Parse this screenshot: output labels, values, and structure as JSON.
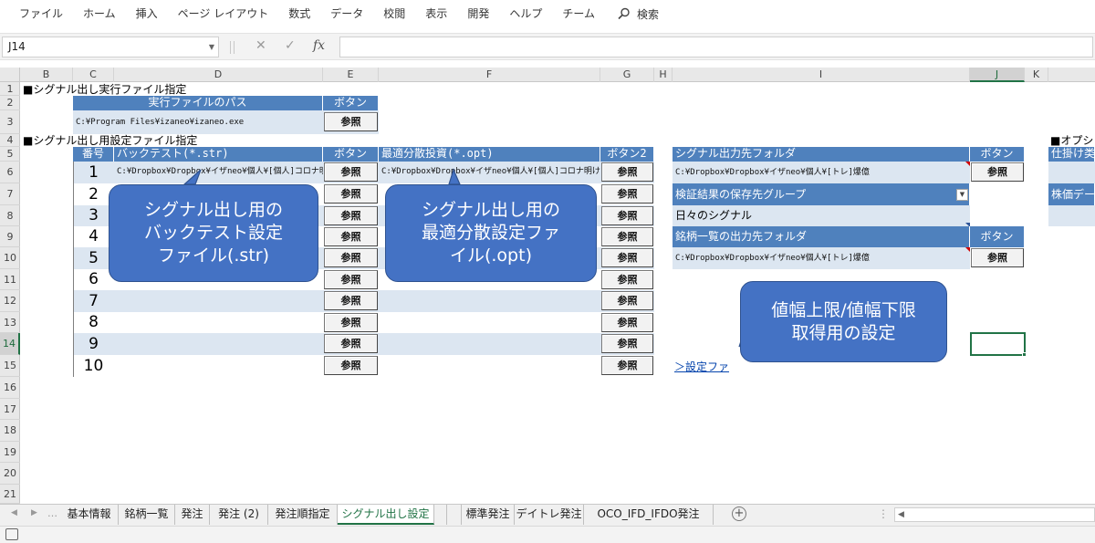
{
  "ribbon": {
    "tabs": [
      "ファイル",
      "ホーム",
      "挿入",
      "ページ レイアウト",
      "数式",
      "データ",
      "校閲",
      "表示",
      "開発",
      "ヘルプ",
      "チーム"
    ],
    "search_label": "検索"
  },
  "formula_bar": {
    "name_box": "J14",
    "cancel_icon": "✕",
    "enter_icon": "✓",
    "fx_label": "fx",
    "formula": ""
  },
  "columns": [
    "B",
    "C",
    "D",
    "E",
    "F",
    "G",
    "H",
    "I",
    "J",
    "K"
  ],
  "rows": [
    "1",
    "2",
    "3",
    "4",
    "5",
    "6",
    "7",
    "8",
    "9",
    "10",
    "11",
    "12",
    "13",
    "14",
    "15",
    "16",
    "17",
    "18",
    "19",
    "20",
    "21"
  ],
  "section1": {
    "title": "■シグナル出し実行ファイル指定",
    "path_header": "実行ファイルのパス",
    "button_header": "ボタン",
    "exe_path": "C:¥Program Files¥izaneo¥izaneo.exe",
    "button_label": "参照"
  },
  "section2": {
    "title": "■シグナル出し用設定ファイル指定",
    "col_no": "番号",
    "col_backtest": "バックテスト(*.str)",
    "col_button": "ボタン",
    "col_opt": "最適分散投資(*.opt)",
    "col_button2": "ボタン2",
    "button_label": "参照",
    "rows": [
      {
        "no": "1",
        "str_path": "C:¥Dropbox¥Dropbox¥イザneo¥個人¥[個人]コロナ明け",
        "opt_path": "C:¥Dropbox¥Dropbox¥イザneo¥個人¥[個人]コロナ明け¥"
      },
      {
        "no": "2",
        "str_path": "",
        "opt_path": ""
      },
      {
        "no": "3",
        "str_path": "",
        "opt_path": ""
      },
      {
        "no": "4",
        "str_path": "",
        "opt_path": ""
      },
      {
        "no": "5",
        "str_path": "",
        "opt_path": ""
      },
      {
        "no": "6",
        "str_path": "",
        "opt_path": ""
      },
      {
        "no": "7",
        "str_path": "",
        "opt_path": ""
      },
      {
        "no": "8",
        "str_path": "",
        "opt_path": ""
      },
      {
        "no": "9",
        "str_path": "",
        "opt_path": ""
      },
      {
        "no": "10",
        "str_path": "",
        "opt_path": ""
      }
    ]
  },
  "output": {
    "signal_folder_header": "シグナル出力先フォルダ",
    "signal_folder_button_header": "ボタン",
    "signal_folder_path": "C:¥Dropbox¥Dropbox¥イザneo¥個人¥[トレ]爆億",
    "signal_folder_button": "参照",
    "verify_group_header": "検証結果の保存先グループ",
    "verify_group_value": "日々のシグナル",
    "stock_list_header": "銘柄一覧の出力先フォルダ",
    "stock_list_button_header": "ボタン",
    "stock_list_path": "C:¥Dropbox¥Dropbox¥イザneo¥個人¥[トレ]爆億",
    "stock_list_button": "参照",
    "settings_link": "＞設定ファ"
  },
  "right_edge": {
    "title": "■オプシ",
    "item1": "仕掛け类",
    "item2": "株価デー"
  },
  "callouts": {
    "backtest": "シグナル出し用の\nバックテスト設定\nファイル(.str)",
    "opt": "シグナル出し用の\n最適分散設定ファ\nイル(.opt)",
    "limit": "値幅上限/値幅下限\n取得用の設定"
  },
  "sheet_tabs": [
    "基本情報",
    "銘柄一覧",
    "発注",
    "発注 (2)",
    "発注順指定",
    "シグナル出し設定",
    "",
    "標準発注",
    "デイトレ発注",
    "OCO_IFD_IFDO発注"
  ],
  "active_sheet": "シグナル出し設定",
  "colors": {
    "header_blue": "#4f81bd",
    "band_blue": "#dce6f1",
    "callout_blue": "#4472c4",
    "excel_green": "#217346"
  }
}
